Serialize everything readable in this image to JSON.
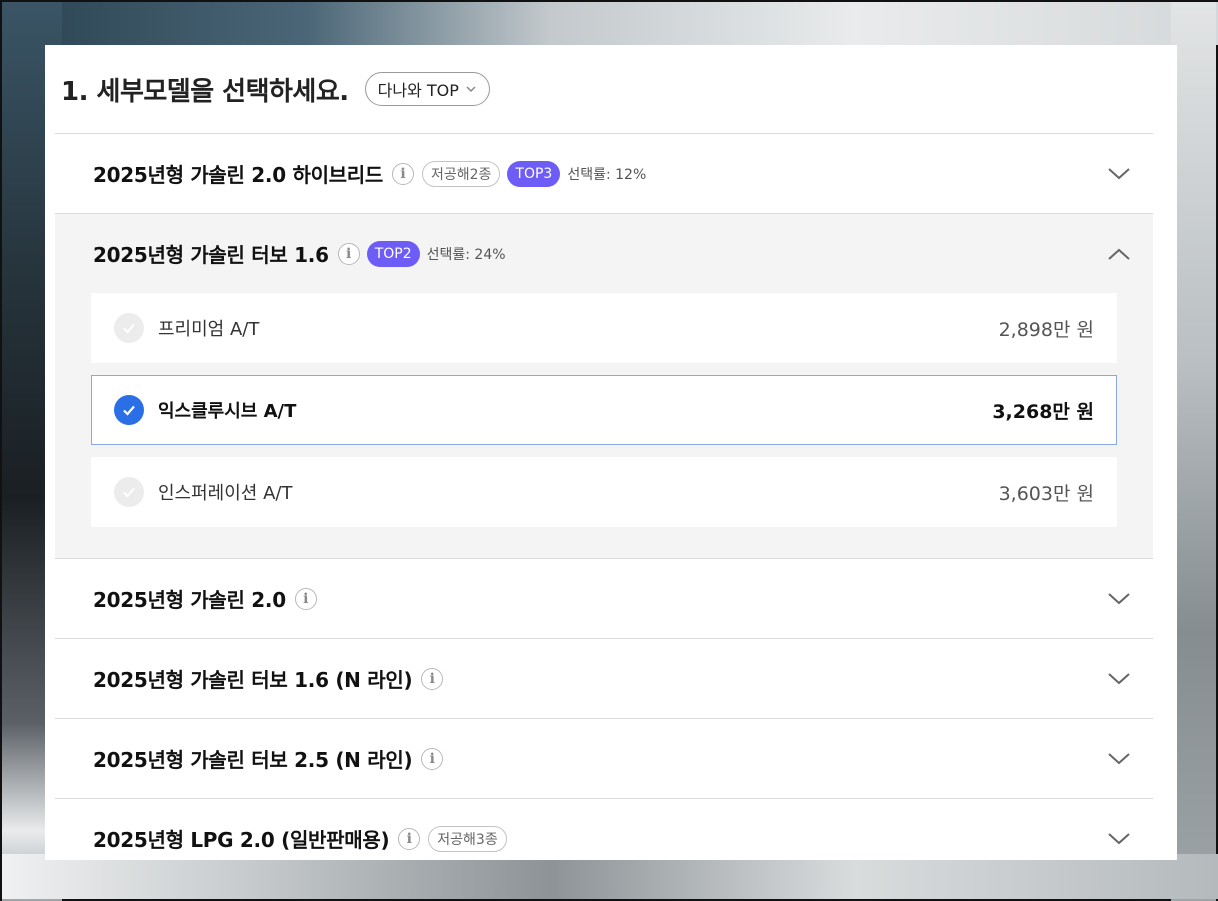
{
  "header": {
    "title": "1. 세부모델을 선택하세요.",
    "sort_label": "다나와 TOP"
  },
  "groups": [
    {
      "title": "2025년형 가솔린 2.0 하이브리드",
      "chip": "저공해2종",
      "badge": "TOP3",
      "rate": "선택률: 12%",
      "expanded": false
    },
    {
      "title": "2025년형 가솔린 터보 1.6",
      "badge": "TOP2",
      "rate": "선택률: 24%",
      "expanded": true,
      "options": [
        {
          "name": "프리미엄 A/T",
          "price": "2,898만 원",
          "selected": false
        },
        {
          "name": "익스클루시브 A/T",
          "price": "3,268만 원",
          "selected": true
        },
        {
          "name": "인스퍼레이션 A/T",
          "price": "3,603만 원",
          "selected": false
        }
      ]
    },
    {
      "title": "2025년형 가솔린 2.0",
      "expanded": false
    },
    {
      "title": "2025년형 가솔린 터보 1.6 (N 라인)",
      "expanded": false
    },
    {
      "title": "2025년형 가솔린 터보 2.5 (N 라인)",
      "expanded": false
    },
    {
      "title": "2025년형 LPG 2.0 (일반판매용)",
      "chip": "저공해3종",
      "expanded": false
    }
  ],
  "icons": {
    "info": "i",
    "check": "check-icon",
    "chevron": "chevron-icon"
  },
  "colors": {
    "badge": "#6e5cf6",
    "selected_check": "#2a6fe6",
    "selected_border": "#8aa8e6"
  }
}
